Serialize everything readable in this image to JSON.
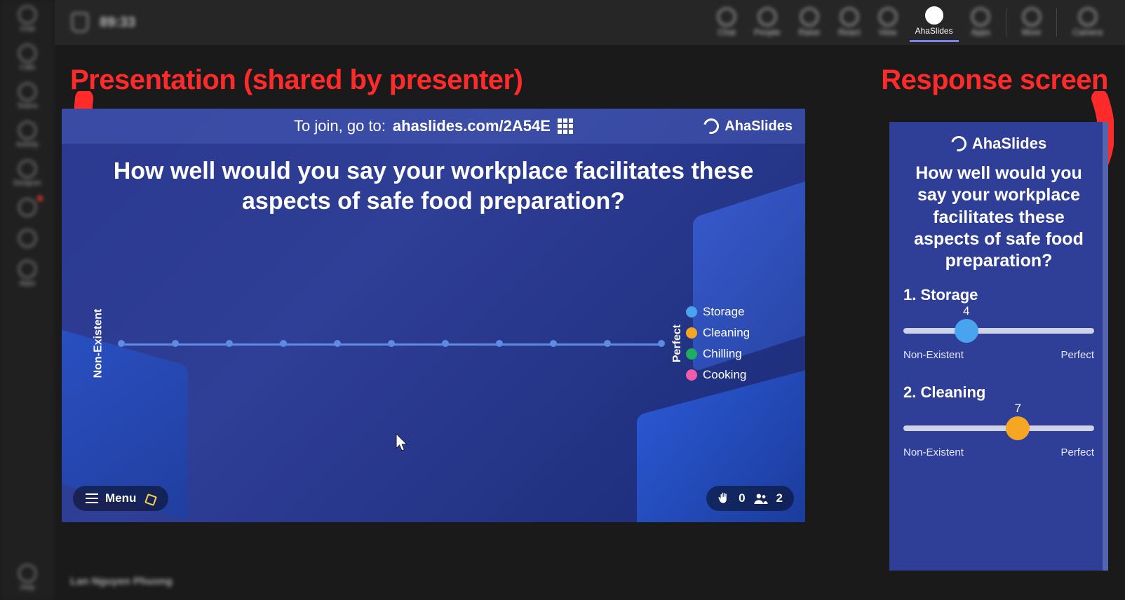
{
  "left_rail": {
    "items": [
      "Chat",
      "Calls",
      "Teams",
      "Activity",
      "Designer",
      "",
      "",
      "Apps"
    ],
    "bottom": "Help"
  },
  "top_bar": {
    "time": "89:33",
    "buttons": [
      {
        "label": "Chat"
      },
      {
        "label": "People"
      },
      {
        "label": "Raise"
      },
      {
        "label": "React"
      },
      {
        "label": "View"
      },
      {
        "label": "AhaSlides",
        "active": true
      },
      {
        "label": "Apps"
      },
      {
        "label": "More"
      },
      {
        "label": "Camera"
      }
    ]
  },
  "annotations": {
    "left": "Presentation (shared by presenter)",
    "right": "Response screen"
  },
  "presentation": {
    "join_prefix": "To join, go to: ",
    "join_url": "ahaslides.com/2A54E",
    "brand": "AhaSlides",
    "question": "How well would you say your workplace facilitates these aspects of safe food preparation?",
    "axis_left": "Non-Existent",
    "axis_right": "Perfect",
    "legend": [
      {
        "label": "Storage",
        "color": "#4aa3ef"
      },
      {
        "label": "Cleaning",
        "color": "#f5a623"
      },
      {
        "label": "Chilling",
        "color": "#1fae5f"
      },
      {
        "label": "Cooking",
        "color": "#ef5da8"
      }
    ],
    "menu_label": "Menu",
    "hand_count": "0",
    "people_count": "2"
  },
  "response": {
    "brand": "AhaSlides",
    "question": "How well would you say your workplace facilitates these aspects of safe food preparation?",
    "scale_left": "Non-Existent",
    "scale_right": "Perfect",
    "items": [
      {
        "index": "1.",
        "label": "Storage",
        "value": "4",
        "pct": 33,
        "color": "#4aa3ef"
      },
      {
        "index": "2.",
        "label": "Cleaning",
        "value": "7",
        "pct": 60,
        "color": "#f5a623"
      }
    ]
  },
  "chart_data": {
    "type": "line",
    "title": "How well would you say your workplace facilitates these aspects of safe food preparation?",
    "xlabel_left": "Non-Existent",
    "xlabel_right": "Perfect",
    "x": [
      1,
      2,
      3,
      4,
      5,
      6,
      7,
      8,
      9,
      10,
      11
    ],
    "series": [
      {
        "name": "Storage",
        "color": "#4aa3ef",
        "values": [
          5,
          5,
          5,
          5,
          5,
          5,
          5,
          5,
          5,
          5,
          5
        ]
      },
      {
        "name": "Cleaning",
        "color": "#f5a623",
        "values": [
          5,
          5,
          5,
          5,
          5,
          5,
          5,
          5,
          5,
          5,
          5
        ]
      },
      {
        "name": "Chilling",
        "color": "#1fae5f",
        "values": [
          5,
          5,
          5,
          5,
          5,
          5,
          5,
          5,
          5,
          5,
          5
        ]
      },
      {
        "name": "Cooking",
        "color": "#ef5da8",
        "values": [
          5,
          5,
          5,
          5,
          5,
          5,
          5,
          5,
          5,
          5,
          5
        ]
      }
    ],
    "ylim": [
      0,
      10
    ],
    "note": "All series overlap on a flat baseline in the screenshot (no responses yet)."
  },
  "bottom_name": "Lan Nguyen Phuong"
}
